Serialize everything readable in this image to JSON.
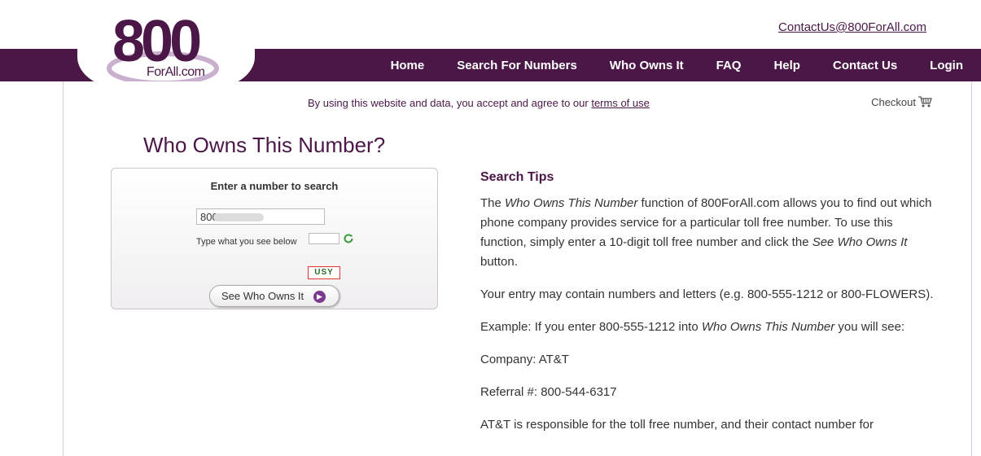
{
  "header": {
    "contact_email": "ContactUs@800ForAll.com",
    "logo_main": "800",
    "logo_sub": "ForAll.com"
  },
  "nav": {
    "items": [
      {
        "label": "Home"
      },
      {
        "label": "Search For Numbers"
      },
      {
        "label": "Who Owns It"
      },
      {
        "label": "FAQ"
      },
      {
        "label": "Help"
      },
      {
        "label": "Contact Us"
      },
      {
        "label": "Login"
      }
    ]
  },
  "notice": {
    "text": "By using this website and data, you accept and agree to our ",
    "link": "terms of use"
  },
  "checkout": {
    "label": "Checkout"
  },
  "page": {
    "title": "Who Owns This Number?"
  },
  "search": {
    "title": "Enter a number to search",
    "number_value": "800      31",
    "captcha_label": "Type what you see below",
    "captcha_text": "USY",
    "button_label": "See Who Owns It"
  },
  "tips": {
    "heading": "Search Tips",
    "p1_a": "The ",
    "p1_em": "Who Owns This Number",
    "p1_b": " function of 800ForAll.com allows you to find out which phone company provides service for a particular toll free number. To use this function, simply enter a 10-digit toll free number and click the ",
    "p1_em2": "See Who Owns It",
    "p1_c": " button.",
    "p2": "Your entry may contain numbers and letters (e.g. 800-555-1212 or 800-FLOWERS).",
    "p3_a": "Example: If you enter 800-555-1212 into ",
    "p3_em": "Who Owns This Number",
    "p3_b": " you will see:",
    "p4": "Company: AT&T",
    "p5": "Referral #: 800-544-6317",
    "p6": "AT&T is responsible for the toll free number, and their contact number for"
  },
  "colors": {
    "brand": "#4a1747",
    "accent": "#7b3a8f"
  }
}
